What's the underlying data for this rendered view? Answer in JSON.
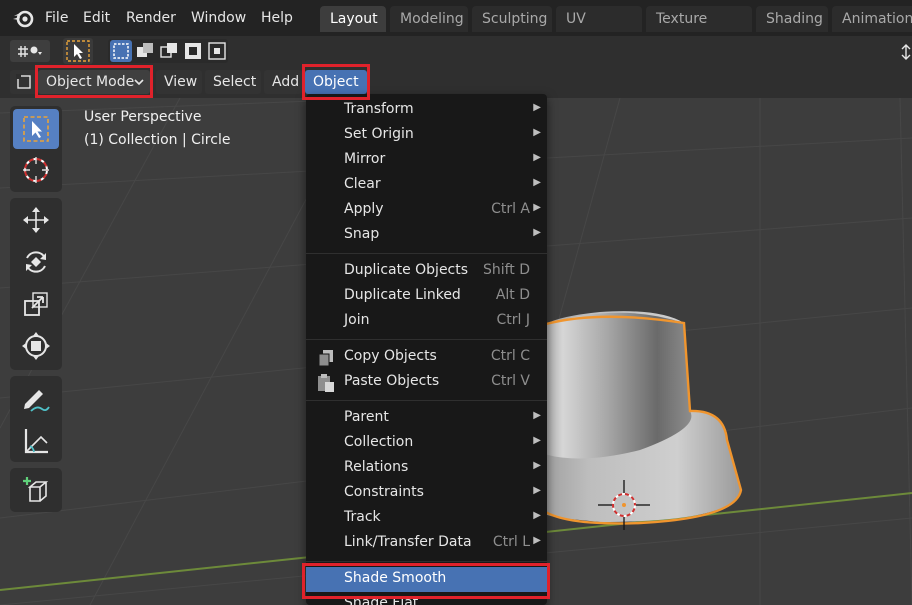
{
  "menubar": {
    "items": [
      "File",
      "Edit",
      "Render",
      "Window",
      "Help"
    ]
  },
  "workspaces": {
    "tabs": [
      "Layout",
      "Modeling",
      "Sculpting",
      "UV Editing",
      "Texture Paint",
      "Shading",
      "Animation"
    ],
    "active": "Layout"
  },
  "viewport_header": {
    "mode": "Object Mode",
    "menus": {
      "view": "View",
      "select": "Select",
      "add": "Add",
      "object": "Object"
    }
  },
  "viewport": {
    "perspective": "User Perspective",
    "collection_info": "(1) Collection | Circle"
  },
  "object_menu": {
    "transform": "Transform",
    "set_origin": "Set Origin",
    "mirror": "Mirror",
    "clear": "Clear",
    "apply": "Apply",
    "apply_shortcut": "Ctrl A",
    "snap": "Snap",
    "duplicate_objects": "Duplicate Objects",
    "duplicate_objects_shortcut": "Shift D",
    "duplicate_linked": "Duplicate Linked",
    "duplicate_linked_shortcut": "Alt D",
    "join": "Join",
    "join_shortcut": "Ctrl J",
    "copy_objects": "Copy Objects",
    "copy_objects_shortcut": "Ctrl C",
    "paste_objects": "Paste Objects",
    "paste_objects_shortcut": "Ctrl V",
    "parent": "Parent",
    "collection": "Collection",
    "relations": "Relations",
    "constraints": "Constraints",
    "track": "Track",
    "link_transfer_data": "Link/Transfer Data",
    "link_transfer_data_shortcut": "Ctrl L",
    "shade_smooth": "Shade Smooth",
    "shade_flat": "Shade Flat"
  },
  "colors": {
    "highlight": "#4772b3",
    "annotation_red": "#e0222b",
    "selection_outline": "#f0952e"
  }
}
